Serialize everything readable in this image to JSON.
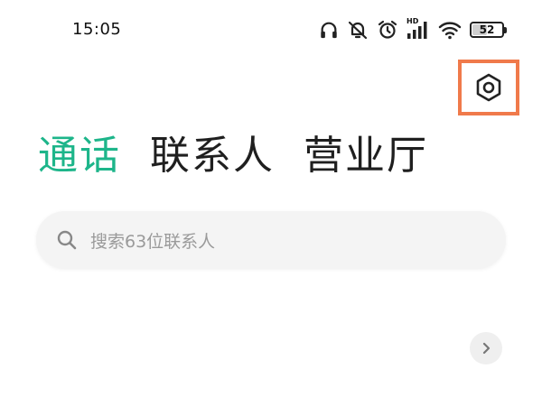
{
  "status_bar": {
    "time": "15:05",
    "hd_label": "HD",
    "battery_level": "52",
    "battery_percent": 52,
    "icons": [
      "headphones-icon",
      "muted-bell-icon",
      "alarm-icon",
      "hd-signal-icon",
      "wifi-icon",
      "battery-icon"
    ]
  },
  "header": {
    "settings_icon": "settings-hexagon-icon",
    "highlight_color": "#f07a4b"
  },
  "tabs": [
    {
      "label": "通话",
      "active": true
    },
    {
      "label": "联系人",
      "active": false
    },
    {
      "label": "营业厅",
      "active": false
    }
  ],
  "search": {
    "placeholder": "搜索63位联系人",
    "icon": "search-icon"
  },
  "colors": {
    "accent": "#1db58a",
    "text": "#1f1f1f",
    "placeholder": "#9a9a9a"
  },
  "chevron": {
    "icon": "chevron-right-icon"
  }
}
